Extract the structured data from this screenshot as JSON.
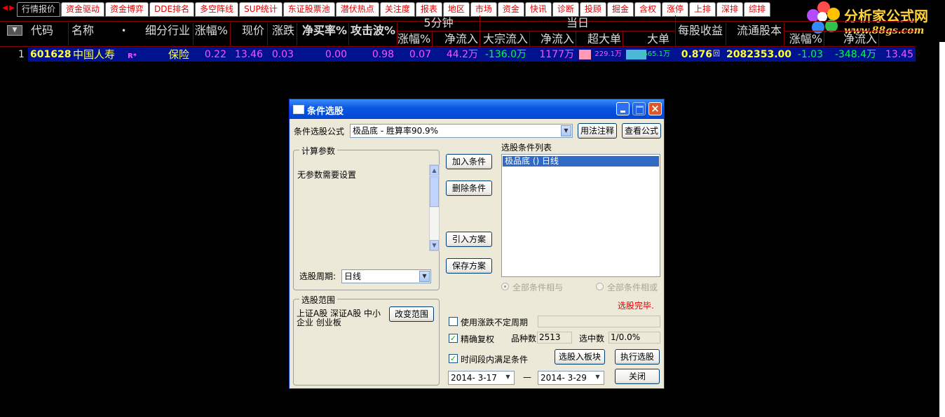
{
  "tabs": [
    "行情报价",
    "资金驱动",
    "资金博弈",
    "DDE排名",
    "多空阵线",
    "SUP统计",
    "东证股票池",
    "潜伏热点",
    "关注度",
    "报表",
    "地区",
    "市场",
    "资金",
    "快讯",
    "诊断",
    "投顾",
    "掘金",
    "含权",
    "涨停",
    "上排",
    "深排",
    "综排"
  ],
  "logo": {
    "name": "分析家公式网",
    "url": "www.88gs.com"
  },
  "header": {
    "menu_icon": "▼",
    "code": "代码",
    "name": "名称",
    "dot": "•",
    "industry": "细分行业",
    "change_pct": "涨幅%",
    "price": "现价",
    "change": "涨跌",
    "net_buy_rate": "净买率%",
    "attack_wave": "攻击波%",
    "five_min": "5分钟",
    "day": "当日",
    "five_min_change": "涨幅%",
    "five_min_inflow": "净流入",
    "block_inflow": "大宗流入",
    "day_inflow": "净流入",
    "super_large": "超大单",
    "large": "大单",
    "eps": "每股收益",
    "float_shares": "流通股本",
    "ext_change": "涨幅%",
    "ext_inflow": "净流入"
  },
  "row": {
    "index": "1",
    "code": "601628",
    "name": "中国人寿",
    "flag": "R*",
    "industry": "保险",
    "change_pct": "0.22",
    "price": "13.46",
    "change": "0.03",
    "net_buy_rate": "0.00",
    "attack_wave": "0.98",
    "five_min_change": "0.07",
    "five_min_inflow": "44.2万",
    "block_inflow": "-136.0万",
    "day_inflow": "1177万",
    "super_large": "229.1万",
    "super_large_fill": 0.45,
    "large": "-565.1万",
    "large_fill": 0.6,
    "eps": "0.876",
    "eps_icon": "回",
    "float_shares": "2082353.00",
    "ext_change": "-1.03",
    "ext_inflow": "-348.4万",
    "ext_price": "13.45"
  },
  "colors": {
    "up": "#ff50ff",
    "down": "#00ff40",
    "yellow": "#ffff40",
    "row_bg": "#001290"
  },
  "dialog": {
    "title": "条件选股",
    "formula_label": "条件选股公式",
    "formula_value": "极品底   - 胜算率90.9%",
    "btn_usage": "用法注释",
    "btn_view": "查看公式",
    "params_group": "计算参数",
    "params_text": "无参数需要设置",
    "period_label": "选股周期:",
    "period_value": "日线",
    "btn_add": "加入条件",
    "btn_delete": "删除条件",
    "btn_import": "引入方案",
    "btn_save": "保存方案",
    "list_label": "选股条件列表",
    "list_items": [
      "极品底  () 日线"
    ],
    "radio_and": "全部条件相与",
    "radio_or": "全部条件相或",
    "status": "选股完毕.",
    "range_group": "选股范围",
    "range_text": "上证A股 深证A股 中小企业 创业板",
    "btn_range": "改变范围",
    "chk_irregular": "使用涨跌不定周期",
    "chk_exact": "精确复权",
    "count_label": "品种数",
    "count_value": "2513",
    "selected_label": "选中数",
    "selected_value": "1/0.0%",
    "chk_timerange": "时间段内满足条件",
    "btn_to_block": "选股入板块",
    "btn_execute": "执行选股",
    "date_start": "2014- 3-17",
    "date_sep": "—",
    "date_end": "2014- 3-29",
    "btn_close": "关闭"
  }
}
